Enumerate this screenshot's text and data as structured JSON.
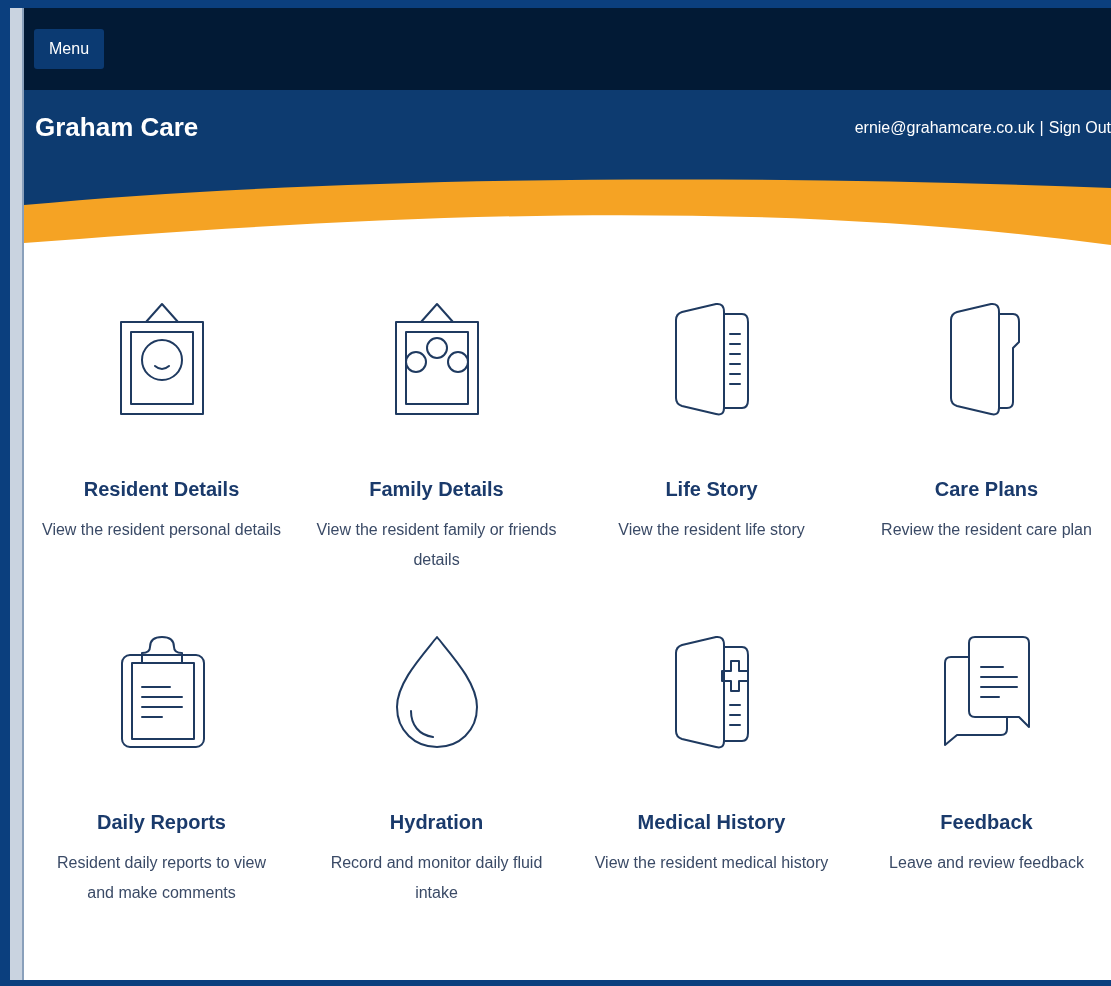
{
  "nav": {
    "menu_button": "Menu"
  },
  "header": {
    "title": "Graham Care",
    "email": "ernie@grahamcare.co.uk",
    "separator": "|",
    "sign_out": "Sign Out"
  },
  "tiles": [
    {
      "kind": "portrait",
      "title": "Resident Details",
      "description": "View the resident personal details"
    },
    {
      "kind": "group",
      "title": "Family Details",
      "description": "View the resident family or friends details"
    },
    {
      "kind": "book",
      "title": "Life Story",
      "description": "View the resident life story"
    },
    {
      "kind": "folder",
      "title": "Care Plans",
      "description": "Review the resident care plan"
    },
    {
      "kind": "clipboard",
      "title": "Daily Reports",
      "description": "Resident daily reports to view and make comments"
    },
    {
      "kind": "drop",
      "title": "Hydration",
      "description": "Record and monitor daily fluid intake"
    },
    {
      "kind": "medical",
      "title": "Medical History",
      "description": "View the resident medical history"
    },
    {
      "kind": "chat",
      "title": "Feedback",
      "description": "Leave and review feedback"
    }
  ]
}
